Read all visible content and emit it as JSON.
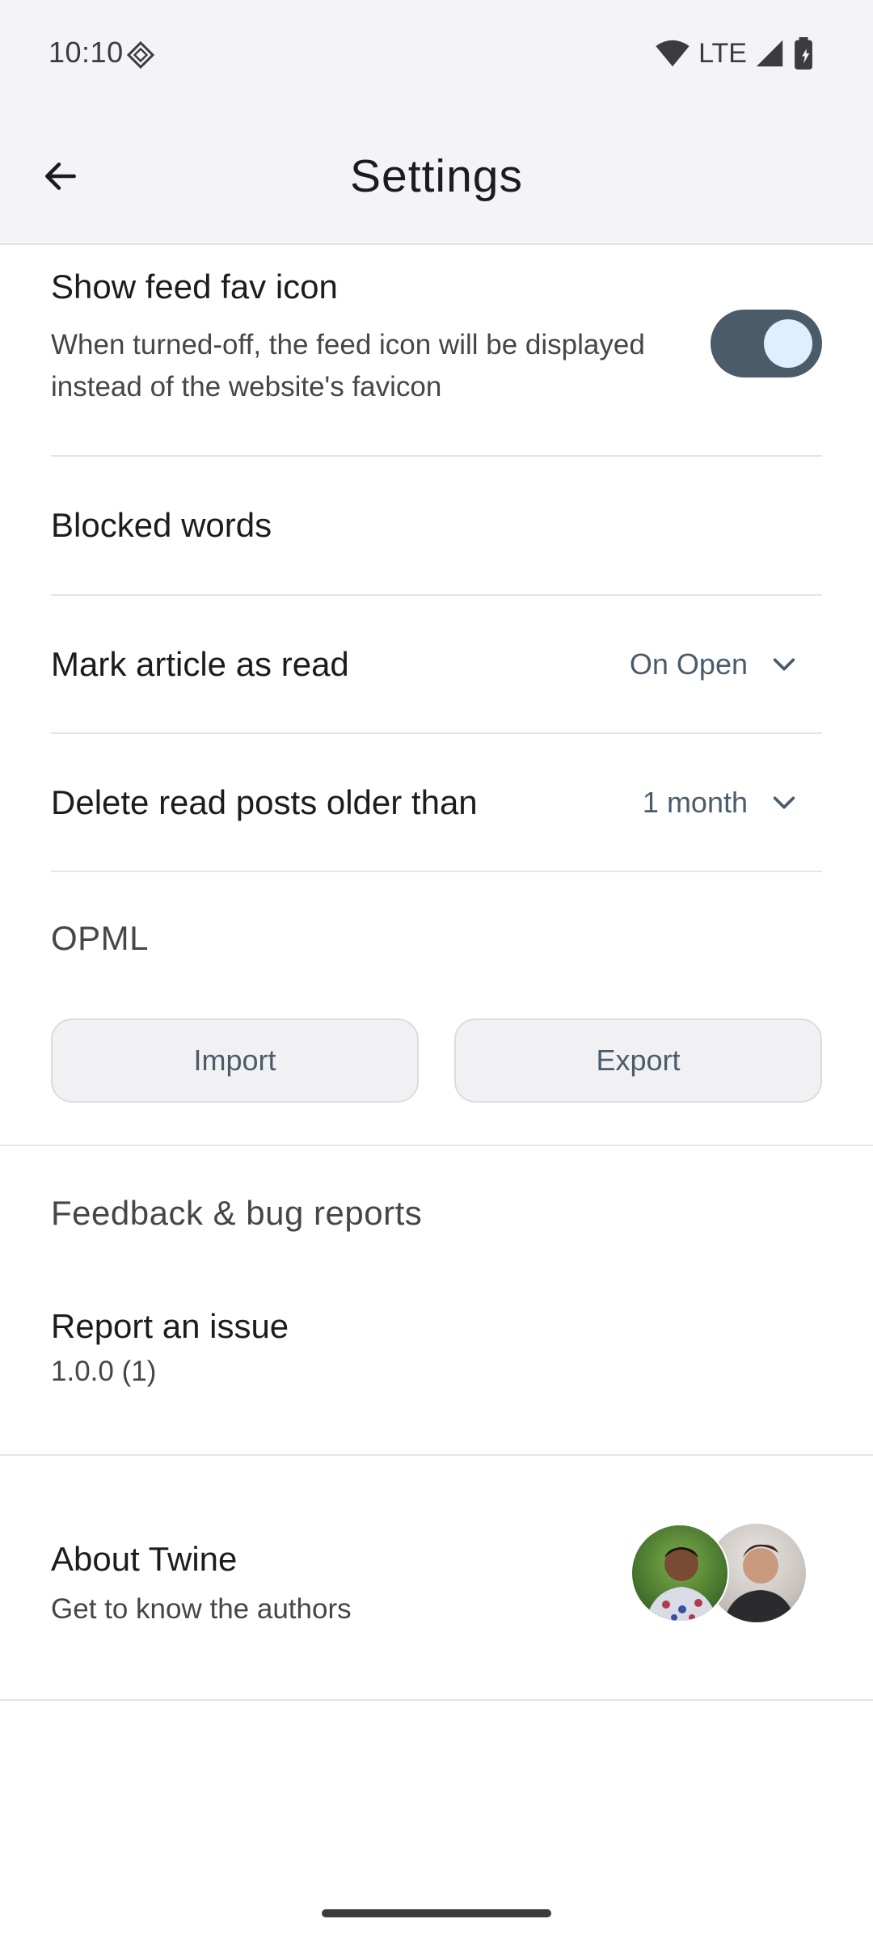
{
  "status_bar": {
    "time": "10:10",
    "network": "LTE",
    "icons": [
      "vpn-diamond-icon",
      "wifi-icon",
      "signal-icon",
      "battery-icon"
    ]
  },
  "header": {
    "title": "Settings",
    "back_icon": "arrow-left-icon"
  },
  "settings": {
    "fav_icon": {
      "title": "Show feed fav icon",
      "description": "When turned-off, the feed icon will be displayed instead of the website's favicon",
      "enabled": true
    },
    "blocked_words": {
      "title": "Blocked words"
    },
    "mark_read": {
      "title": "Mark article as read",
      "value": "On Open"
    },
    "delete_old": {
      "title": "Delete read posts older than",
      "value": "1 month"
    },
    "opml": {
      "label": "OPML",
      "import_label": "Import",
      "export_label": "Export"
    },
    "feedback": {
      "label": "Feedback & bug reports",
      "report_title": "Report an issue",
      "version": "1.0.0 (1)"
    },
    "about": {
      "title": "About Twine",
      "subtitle": "Get to know the authors"
    }
  },
  "colors": {
    "accent": "#4a5c6a",
    "toggle_knob": "#dfefff",
    "surface": "#f4f3f5"
  }
}
